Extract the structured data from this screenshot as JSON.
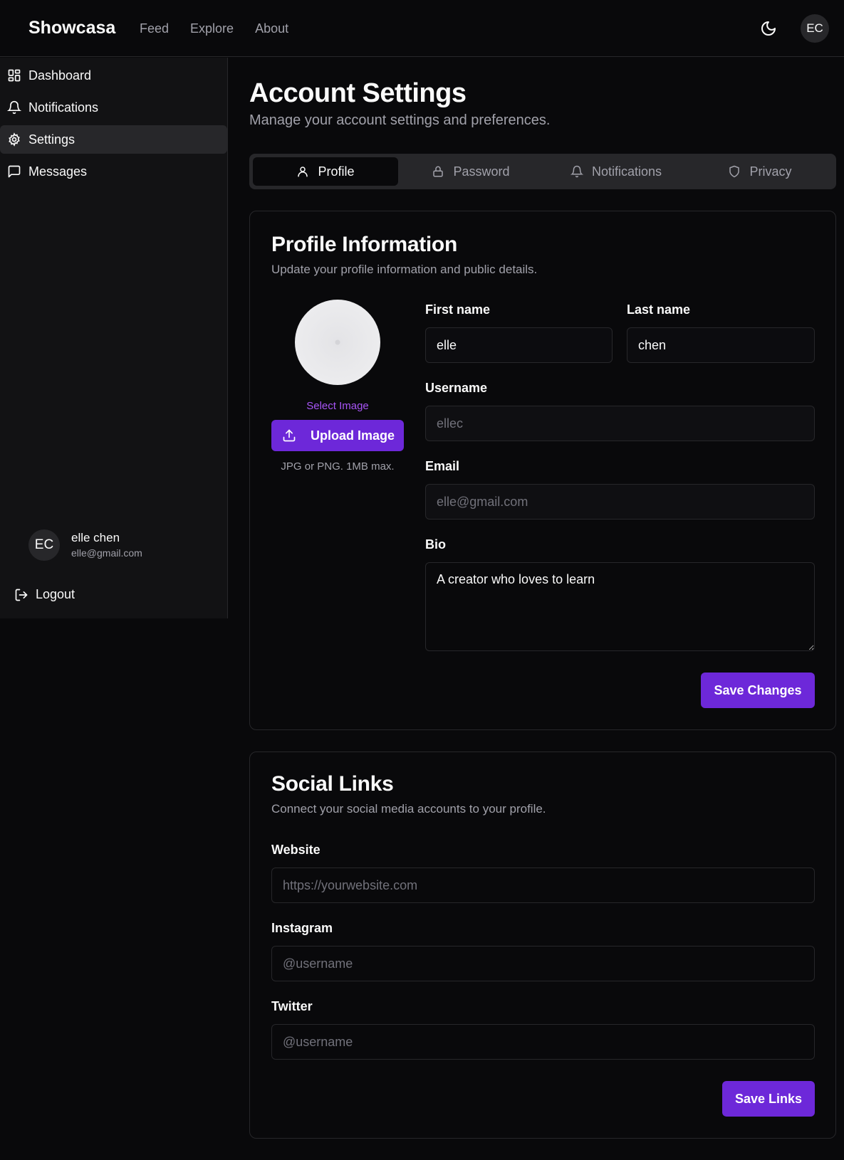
{
  "app": {
    "brand": "Showcasa",
    "nav": [
      "Feed",
      "Explore",
      "About"
    ],
    "avatar_initials": "EC"
  },
  "sidebar": {
    "items": [
      {
        "label": "Dashboard",
        "icon": "dashboard-icon"
      },
      {
        "label": "Notifications",
        "icon": "bell-icon"
      },
      {
        "label": "Settings",
        "icon": "gear-icon",
        "active": true
      },
      {
        "label": "Messages",
        "icon": "message-icon"
      }
    ],
    "user": {
      "initials": "EC",
      "name": "elle chen",
      "email": "elle@gmail.com"
    },
    "logout_label": "Logout"
  },
  "page": {
    "title": "Account Settings",
    "subtitle": "Manage your account settings and preferences."
  },
  "tabs": [
    {
      "label": "Profile",
      "icon": "user-icon",
      "active": true
    },
    {
      "label": "Password",
      "icon": "lock-icon"
    },
    {
      "label": "Notifications",
      "icon": "bell-icon"
    },
    {
      "label": "Privacy",
      "icon": "shield-icon"
    }
  ],
  "profile": {
    "title": "Profile Information",
    "subtitle": "Update your profile information and public details.",
    "select_image": "Select Image",
    "upload_label": "Upload Image",
    "upload_hint": "JPG or PNG. 1MB max.",
    "first_name": {
      "label": "First name",
      "value": "elle"
    },
    "last_name": {
      "label": "Last name",
      "value": "chen"
    },
    "username": {
      "label": "Username",
      "placeholder": "ellec"
    },
    "email": {
      "label": "Email",
      "placeholder": "elle@gmail.com"
    },
    "bio": {
      "label": "Bio",
      "value": "A creator who loves to learn"
    },
    "save_label": "Save Changes"
  },
  "social": {
    "title": "Social Links",
    "subtitle": "Connect your social media accounts to your profile.",
    "website": {
      "label": "Website",
      "placeholder": "https://yourwebsite.com"
    },
    "instagram": {
      "label": "Instagram",
      "placeholder": "@username"
    },
    "twitter": {
      "label": "Twitter",
      "placeholder": "@username"
    },
    "save_label": "Save Links"
  },
  "colors": {
    "accent": "#6d28d9",
    "link": "#a855f7",
    "background": "#09090b",
    "border": "#27272a"
  }
}
